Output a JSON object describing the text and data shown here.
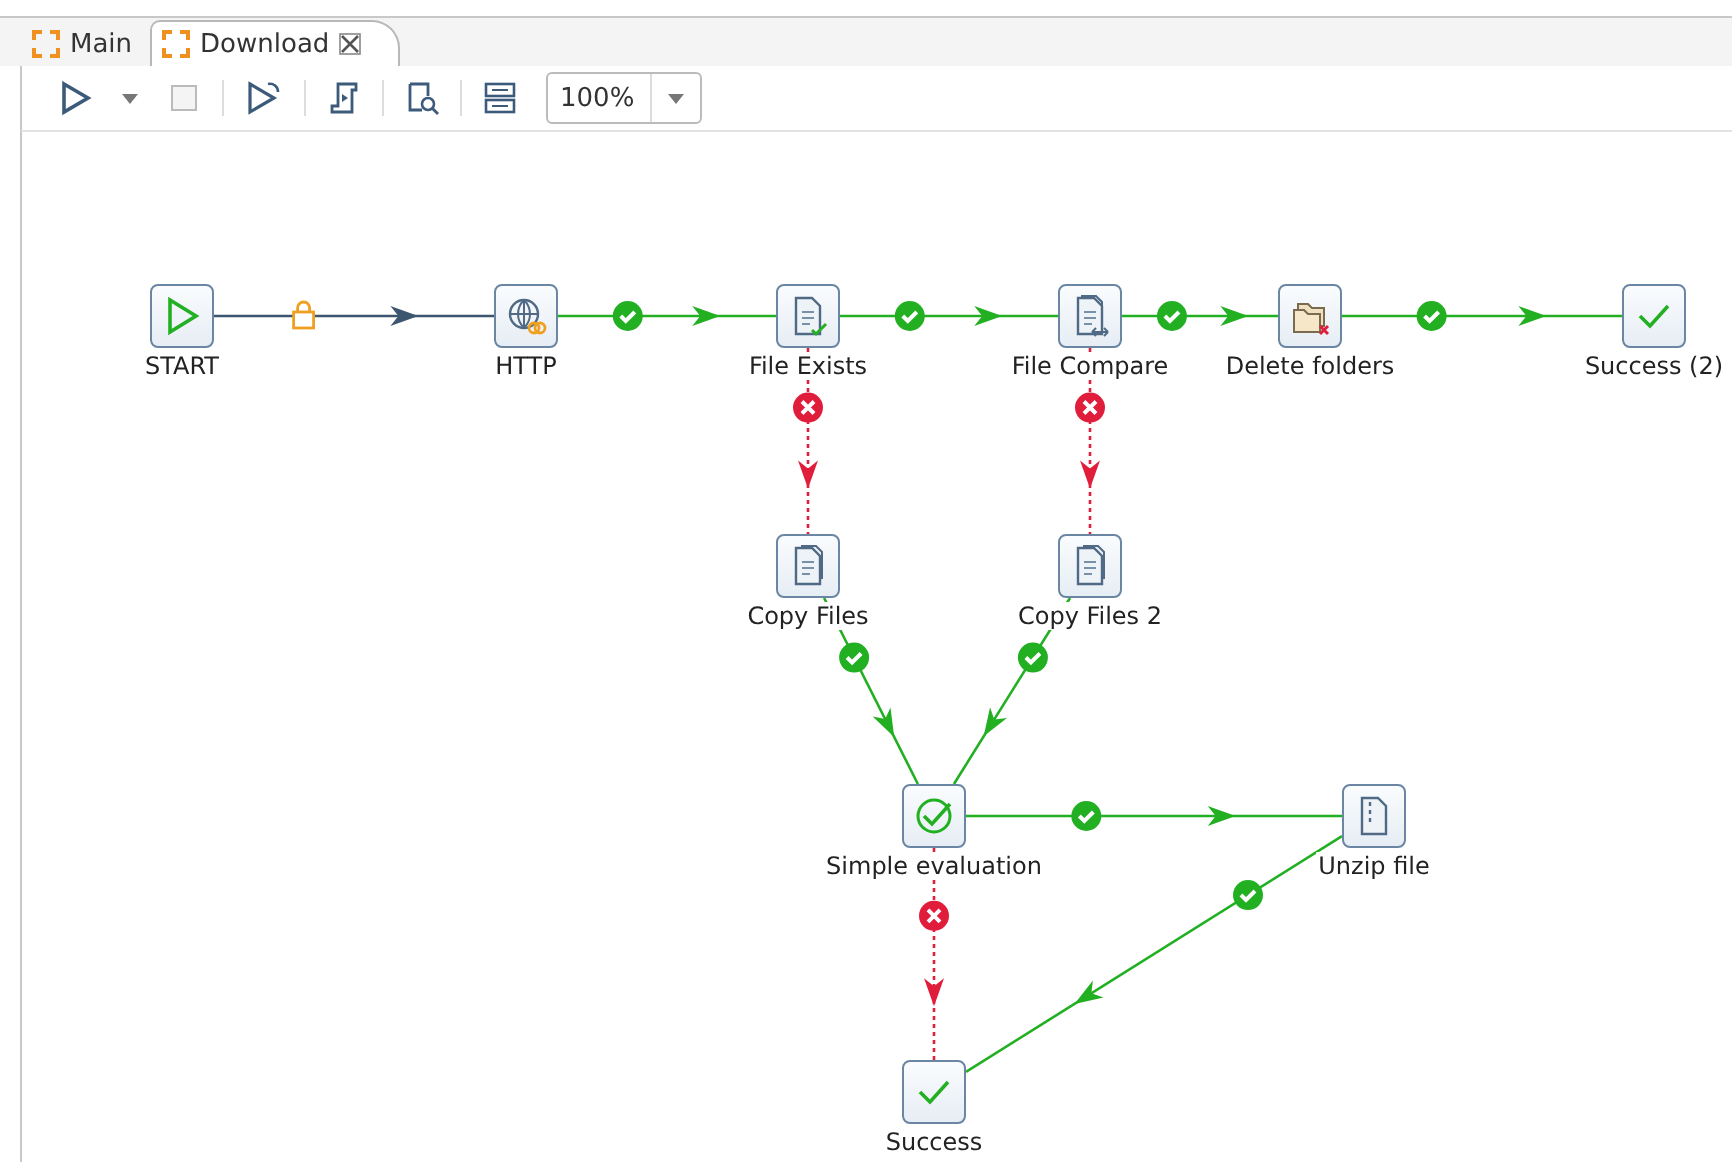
{
  "tabs": [
    {
      "label": "Main",
      "selected": false,
      "closable": false
    },
    {
      "label": "Download",
      "selected": true,
      "closable": true
    }
  ],
  "toolbar": {
    "buttons": [
      {
        "kind": "run",
        "disabled": false
      },
      {
        "kind": "run-menu",
        "disabled": false
      },
      {
        "kind": "stop",
        "disabled": true
      },
      {
        "kind": "preview",
        "disabled": false
      },
      {
        "kind": "script",
        "disabled": false
      },
      {
        "kind": "inspect",
        "disabled": false
      },
      {
        "kind": "layout",
        "disabled": false
      }
    ],
    "zoom": {
      "value": "100%"
    }
  },
  "nodes": [
    {
      "label": "START",
      "kind": "start"
    },
    {
      "label": "HTTP",
      "kind": "http"
    },
    {
      "label": "File Exists",
      "kind": "file-exists"
    },
    {
      "label": "File Compare",
      "kind": "file-compare"
    },
    {
      "label": "Delete folders",
      "kind": "delete-folders"
    },
    {
      "label": "Success (2)",
      "kind": "success"
    },
    {
      "label": "Copy Files",
      "kind": "copy-files"
    },
    {
      "label": "Copy Files 2",
      "kind": "copy-files"
    },
    {
      "label": "Simple evaluation",
      "kind": "evaluation"
    },
    {
      "label": "Unzip file",
      "kind": "unzip"
    },
    {
      "label": "Success",
      "kind": "success"
    }
  ],
  "hops": [
    {
      "kind": "unconditional"
    },
    {
      "kind": "success"
    },
    {
      "kind": "success"
    },
    {
      "kind": "success"
    },
    {
      "kind": "success"
    },
    {
      "kind": "failure"
    },
    {
      "kind": "failure"
    },
    {
      "kind": "success"
    },
    {
      "kind": "success"
    },
    {
      "kind": "success"
    },
    {
      "kind": "failure"
    },
    {
      "kind": "success"
    }
  ]
}
